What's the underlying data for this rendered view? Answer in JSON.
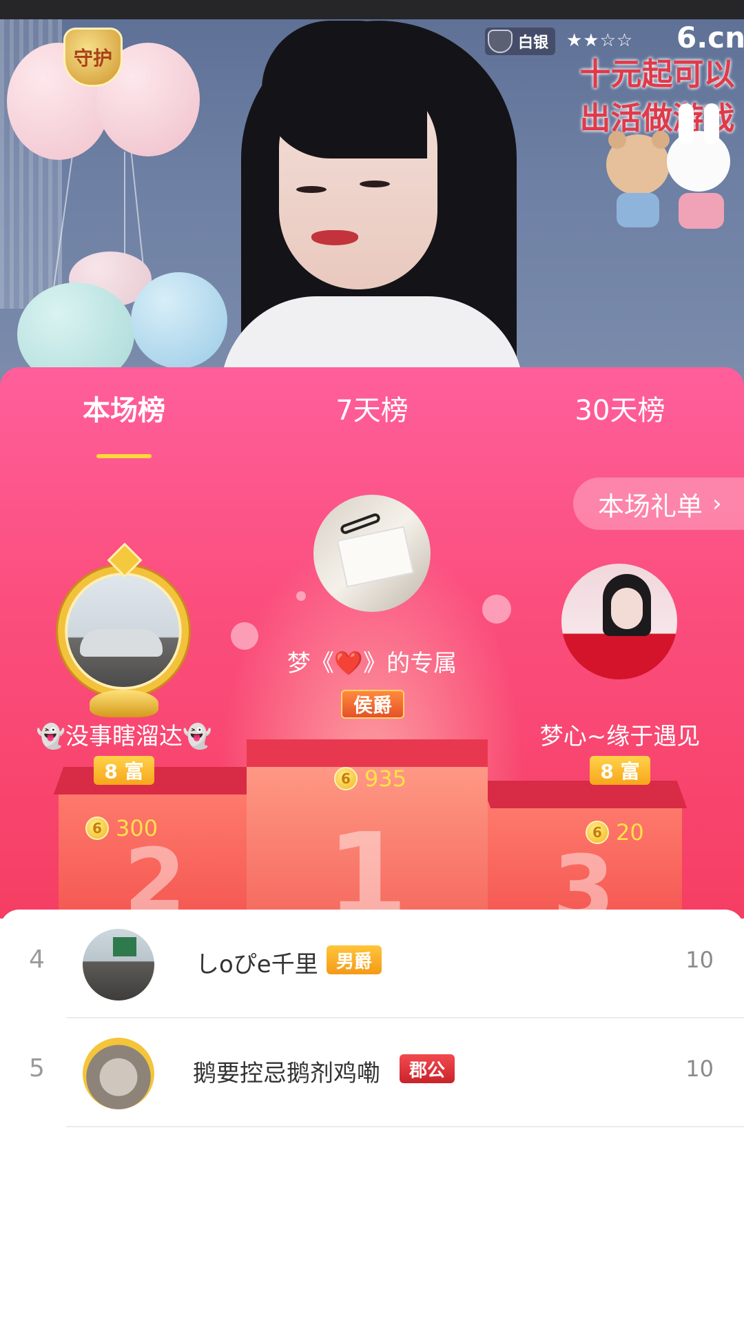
{
  "stream": {
    "guard_badge": "守护",
    "level_label": "白银",
    "stars": "★★☆☆",
    "site_logo": "6.cn",
    "promo_line1": "十元起可以",
    "promo_line2": "出活做游戏"
  },
  "tabs": [
    {
      "label": "本场榜",
      "active": true
    },
    {
      "label": "7天榜",
      "active": false
    },
    {
      "label": "30天榜",
      "active": false
    }
  ],
  "gift_list_button": {
    "label": "本场礼单",
    "icon": "chevron-right-icon"
  },
  "podium": {
    "first": {
      "rank": "1",
      "name": "梦《❤️》的专属",
      "title": "侯爵",
      "score": "935"
    },
    "second": {
      "rank": "2",
      "name": "👻没事瞎溜达👻",
      "title": "8 富",
      "score": "300"
    },
    "third": {
      "rank": "3",
      "name": "梦心~缘于遇见",
      "title": "8 富",
      "score": "20"
    }
  },
  "coin_glyph": "6",
  "list": [
    {
      "rank": "4",
      "name": "しoぴe千里",
      "title": "男爵",
      "title_color": "#f7a21e",
      "value": "10"
    },
    {
      "rank": "5",
      "name": "鹅要控忌鹅剂鸡嘞",
      "title": "郡公",
      "title_color": "#e8383d",
      "value": "10"
    }
  ],
  "colors": {
    "panel_top": "#ff5f9b",
    "panel_bottom": "#f63e63",
    "tab_underline": "#ffd83a",
    "score": "#ffe14a"
  }
}
